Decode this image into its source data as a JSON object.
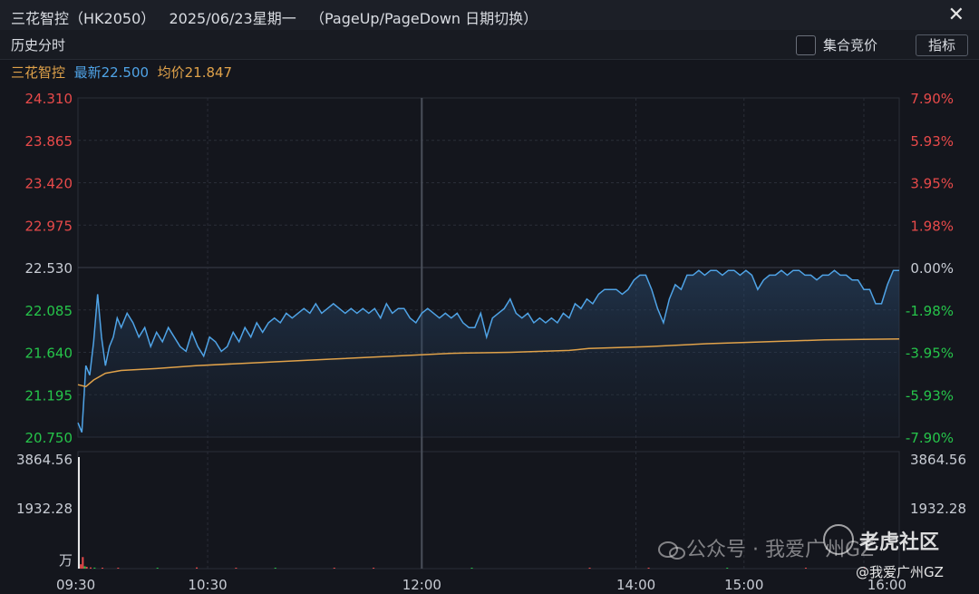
{
  "window": {
    "title": "三花智控（HK2050）   2025/06/23星期一   （PageUp/PageDown 日期切换）",
    "close_icon": "close-icon"
  },
  "toolbar": {
    "tab": "历史分时",
    "checkbox_label": "集合竞价",
    "indicator_button": "指标"
  },
  "legend": {
    "stock": "三花智控",
    "latest": "最新22.500",
    "avg": "均价21.847"
  },
  "colors": {
    "up": "#e84a4a",
    "down": "#26c44a",
    "price_line": "#4fa3e6",
    "avg_line": "#e0a24a",
    "grid": "#2a2e38"
  },
  "chart_data": {
    "type": "line",
    "price_axis_left": [
      "24.310",
      "23.865",
      "23.420",
      "22.975",
      "22.530",
      "22.085",
      "21.640",
      "21.195",
      "20.750"
    ],
    "pct_axis_right": [
      "7.90%",
      "5.93%",
      "3.95%",
      "1.98%",
      "0.00%",
      "-1.98%",
      "-3.95%",
      "-5.93%",
      "-7.90%"
    ],
    "volume_axis": [
      "3864.56",
      "1932.28",
      "万"
    ],
    "x_ticks": [
      "09:30",
      "10:30",
      "12:00",
      "14:00",
      "15:00",
      "16:00"
    ],
    "ylim": [
      20.75,
      24.31
    ],
    "prev_close": 22.53,
    "series": [
      {
        "values": [
          [
            0,
            20.9
          ],
          [
            2,
            20.8
          ],
          [
            4,
            21.5
          ],
          [
            6,
            21.4
          ],
          [
            8,
            21.75
          ],
          [
            10,
            22.25
          ],
          [
            12,
            21.8
          ],
          [
            14,
            21.5
          ],
          [
            16,
            21.7
          ],
          [
            18,
            21.8
          ],
          [
            20,
            22.0
          ],
          [
            22,
            21.9
          ],
          [
            25,
            22.05
          ],
          [
            28,
            21.95
          ],
          [
            31,
            21.8
          ],
          [
            34,
            21.9
          ],
          [
            37,
            21.7
          ],
          [
            40,
            21.85
          ],
          [
            43,
            21.75
          ],
          [
            46,
            21.9
          ],
          [
            49,
            21.8
          ],
          [
            52,
            21.7
          ],
          [
            55,
            21.65
          ],
          [
            58,
            21.85
          ],
          [
            61,
            21.7
          ],
          [
            64,
            21.6
          ],
          [
            67,
            21.8
          ],
          [
            70,
            21.75
          ],
          [
            73,
            21.65
          ],
          [
            76,
            21.7
          ],
          [
            79,
            21.85
          ],
          [
            82,
            21.75
          ],
          [
            85,
            21.9
          ],
          [
            88,
            21.8
          ],
          [
            91,
            21.95
          ],
          [
            94,
            21.85
          ],
          [
            97,
            21.95
          ],
          [
            100,
            22.0
          ],
          [
            103,
            21.95
          ],
          [
            106,
            22.05
          ],
          [
            109,
            22.0
          ],
          [
            112,
            22.05
          ],
          [
            115,
            22.1
          ],
          [
            118,
            22.05
          ],
          [
            121,
            22.15
          ],
          [
            124,
            22.05
          ],
          [
            127,
            22.1
          ],
          [
            130,
            22.15
          ],
          [
            133,
            22.1
          ],
          [
            136,
            22.05
          ],
          [
            139,
            22.1
          ],
          [
            142,
            22.05
          ],
          [
            145,
            22.1
          ],
          [
            148,
            22.05
          ],
          [
            151,
            22.1
          ],
          [
            154,
            22.0
          ],
          [
            157,
            22.15
          ],
          [
            160,
            22.05
          ],
          [
            163,
            22.1
          ],
          [
            166,
            22.1
          ],
          [
            169,
            22.0
          ],
          [
            172,
            21.95
          ],
          [
            175,
            22.05
          ],
          [
            178,
            22.1
          ],
          [
            181,
            22.05
          ],
          [
            184,
            22.0
          ],
          [
            187,
            22.05
          ],
          [
            190,
            22.0
          ],
          [
            193,
            22.05
          ],
          [
            196,
            21.95
          ],
          [
            199,
            21.9
          ],
          [
            202,
            21.9
          ],
          [
            205,
            22.05
          ],
          [
            208,
            21.8
          ],
          [
            211,
            22.0
          ],
          [
            214,
            22.05
          ],
          [
            217,
            22.1
          ],
          [
            220,
            22.2
          ],
          [
            223,
            22.05
          ],
          [
            226,
            22.0
          ],
          [
            229,
            22.05
          ],
          [
            232,
            21.95
          ],
          [
            235,
            22.0
          ],
          [
            238,
            21.95
          ],
          [
            241,
            22.0
          ],
          [
            244,
            21.95
          ],
          [
            247,
            22.05
          ],
          [
            250,
            22.0
          ],
          [
            253,
            22.15
          ],
          [
            256,
            22.1
          ],
          [
            259,
            22.2
          ],
          [
            262,
            22.15
          ],
          [
            265,
            22.25
          ],
          [
            268,
            22.3
          ],
          [
            271,
            22.3
          ],
          [
            274,
            22.3
          ],
          [
            277,
            22.25
          ],
          [
            280,
            22.3
          ],
          [
            283,
            22.4
          ],
          [
            286,
            22.45
          ],
          [
            289,
            22.45
          ],
          [
            292,
            22.3
          ],
          [
            295,
            22.1
          ],
          [
            298,
            21.95
          ],
          [
            301,
            22.2
          ],
          [
            304,
            22.35
          ],
          [
            307,
            22.3
          ],
          [
            310,
            22.45
          ],
          [
            313,
            22.45
          ],
          [
            316,
            22.5
          ],
          [
            319,
            22.45
          ],
          [
            322,
            22.5
          ],
          [
            325,
            22.5
          ],
          [
            328,
            22.45
          ],
          [
            331,
            22.5
          ],
          [
            334,
            22.5
          ],
          [
            337,
            22.45
          ],
          [
            340,
            22.5
          ],
          [
            343,
            22.45
          ],
          [
            346,
            22.3
          ],
          [
            349,
            22.4
          ],
          [
            352,
            22.45
          ],
          [
            355,
            22.45
          ],
          [
            358,
            22.5
          ],
          [
            361,
            22.45
          ],
          [
            364,
            22.5
          ],
          [
            367,
            22.5
          ],
          [
            370,
            22.45
          ],
          [
            373,
            22.45
          ],
          [
            376,
            22.4
          ],
          [
            379,
            22.45
          ],
          [
            382,
            22.45
          ],
          [
            385,
            22.5
          ],
          [
            388,
            22.45
          ],
          [
            391,
            22.45
          ],
          [
            394,
            22.4
          ],
          [
            397,
            22.4
          ],
          [
            400,
            22.3
          ],
          [
            403,
            22.3
          ],
          [
            406,
            22.15
          ],
          [
            409,
            22.15
          ],
          [
            412,
            22.35
          ],
          [
            415,
            22.5
          ],
          [
            418,
            22.5
          ]
        ]
      },
      {
        "values": [
          [
            0,
            21.3
          ],
          [
            4,
            21.28
          ],
          [
            8,
            21.35
          ],
          [
            14,
            21.42
          ],
          [
            22,
            21.45
          ],
          [
            40,
            21.47
          ],
          [
            60,
            21.5
          ],
          [
            80,
            21.52
          ],
          [
            100,
            21.54
          ],
          [
            130,
            21.57
          ],
          [
            160,
            21.6
          ],
          [
            190,
            21.63
          ],
          [
            220,
            21.64
          ],
          [
            250,
            21.66
          ],
          [
            260,
            21.68
          ],
          [
            290,
            21.7
          ],
          [
            320,
            21.73
          ],
          [
            350,
            21.75
          ],
          [
            380,
            21.77
          ],
          [
            418,
            21.78
          ]
        ]
      }
    ],
    "volume": [
      [
        0,
        3864.56
      ],
      [
        1,
        150
      ],
      [
        2,
        400
      ],
      [
        3,
        80
      ],
      [
        4,
        60
      ],
      [
        6,
        40
      ],
      [
        8,
        35
      ],
      [
        12,
        30
      ],
      [
        20,
        25
      ],
      [
        40,
        20
      ],
      [
        60,
        40
      ],
      [
        80,
        15
      ],
      [
        100,
        20
      ],
      [
        130,
        15
      ],
      [
        150,
        10
      ],
      [
        200,
        12
      ],
      [
        260,
        25
      ],
      [
        290,
        15
      ],
      [
        330,
        10
      ],
      [
        370,
        10
      ],
      [
        400,
        20
      ],
      [
        418,
        30
      ]
    ]
  },
  "watermark": {
    "wechat": "公众号 · 我爱广州GZ",
    "brand": "老虎社区",
    "handle": "@我爱广州GZ"
  }
}
